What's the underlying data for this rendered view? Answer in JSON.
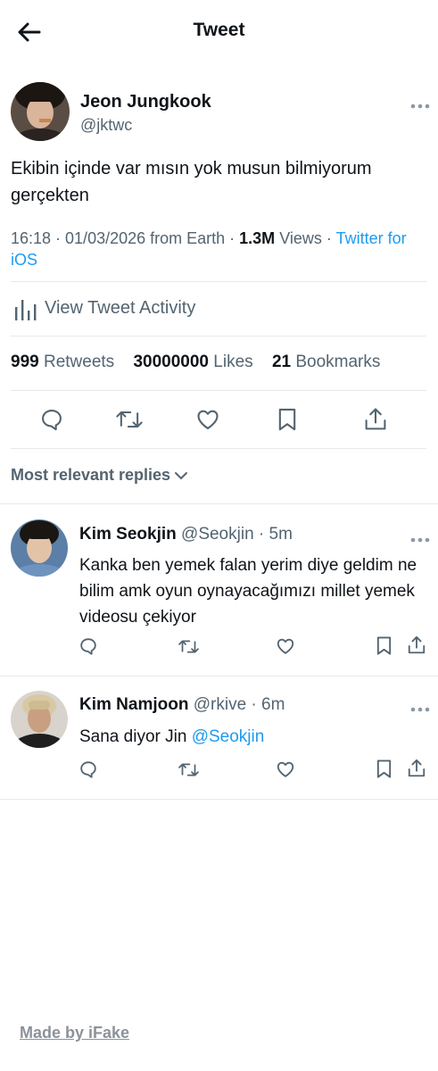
{
  "header": {
    "title": "Tweet"
  },
  "tweet": {
    "author_name": "Jeon Jungkook",
    "author_handle": "@jktwc",
    "text": "Ekibin içinde var mısın yok musun bilmiyorum gerçekten",
    "time_date": "16:18 · 01/03/2026 from Earth · ",
    "views_count": "1.3M",
    "views_label": " Views · ",
    "source_link": "Twitter for iOS"
  },
  "activity_label": "View Tweet Activity",
  "stats": {
    "retweets_count": "999",
    "retweets_label": "Retweets",
    "likes_count": "30000000",
    "likes_label": "Likes",
    "bookmarks_count": "21",
    "bookmarks_label": "Bookmarks"
  },
  "replies_section_label": "Most relevant replies",
  "replies": [
    {
      "name": "Kim Seokjin",
      "handle_time": "@Seokjin · 5m",
      "text": "Kanka ben yemek falan yerim diye geldim ne bilim amk oyun oynayacağımızı millet yemek videosu çekiyor"
    },
    {
      "name": "Kim Namjoon",
      "handle_time": "@rkive · 6m",
      "text": "Sana diyor Jin ",
      "mention": "@Seokjin"
    }
  ],
  "footer": {
    "made_by": "Made by iFake"
  },
  "colors": {
    "accent": "#1d9bf0",
    "text": "#0f1419",
    "secondary": "#536471",
    "divider": "#e6e9ec"
  },
  "icons": [
    "back-arrow-icon",
    "more-icon",
    "activity-bars-icon",
    "reply-icon",
    "retweet-icon",
    "like-icon",
    "bookmark-icon",
    "share-icon",
    "chevron-down-icon"
  ]
}
